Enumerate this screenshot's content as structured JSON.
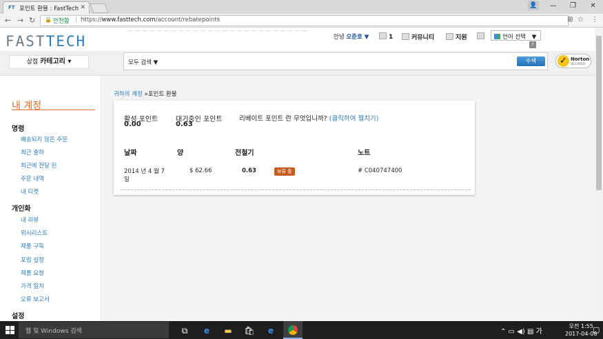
{
  "browser": {
    "tab_title": "포인트 환불 : FastTech",
    "favicon": "FT",
    "secure_label": "안전함",
    "url_prefix": "https://",
    "url_domain": "www.fasttech.com",
    "url_path": "/account/rebatepoints"
  },
  "header": {
    "logo_left": "FAST",
    "logo_right": "TECH",
    "greeting": "안녕",
    "username": "오준호 ▼",
    "cart_count": "1",
    "community": "커뮤니티",
    "support": "지원",
    "language": "언어 선택",
    "lang_arrow": "▼",
    "help": "?"
  },
  "shop": {
    "label": "상점",
    "category": "카테고리 ▾",
    "search_scope": "모두 검색 ▼",
    "search_button": "수색",
    "norton": "Norton",
    "norton_sub": "SECURED"
  },
  "sidebar": {
    "title": "내 계정",
    "sections": [
      {
        "heading": "명령",
        "items": [
          "배송되지 않은 주문",
          "최근 출하",
          "최근에 전달 된",
          "주문 내역",
          "내 티켓"
        ]
      },
      {
        "heading": "개인화",
        "items": [
          "내 리뷰",
          "위시리스트",
          "제품 구독",
          "포럼 설정",
          "제품 요청",
          "가격 일치",
          "오류 보고서"
        ]
      },
      {
        "heading": "설정",
        "items": []
      }
    ]
  },
  "breadcrumb": {
    "link": "귀하의 계정",
    "current": "»포인트 환불"
  },
  "points": {
    "active_label": "활성 포인트",
    "active_value": "0.00",
    "pending_label": "대기중인 포인트",
    "pending_value": "0.63",
    "question": "리베이트 포인트 란 무엇입니까?",
    "expand": "(클릭하여 펼치기)"
  },
  "table": {
    "headers": [
      "날짜",
      "양",
      "전철기",
      "노트"
    ],
    "rows": [
      {
        "date": "2014 년 4 월 7 일",
        "amount": "$ 62.66",
        "points": "0.63",
        "status": "보류 중",
        "note": "# C040747400"
      }
    ]
  },
  "taskbar": {
    "search_placeholder": "웹 및 Windows 검색",
    "time": "오전 1:55",
    "date": "2017-04-08"
  }
}
